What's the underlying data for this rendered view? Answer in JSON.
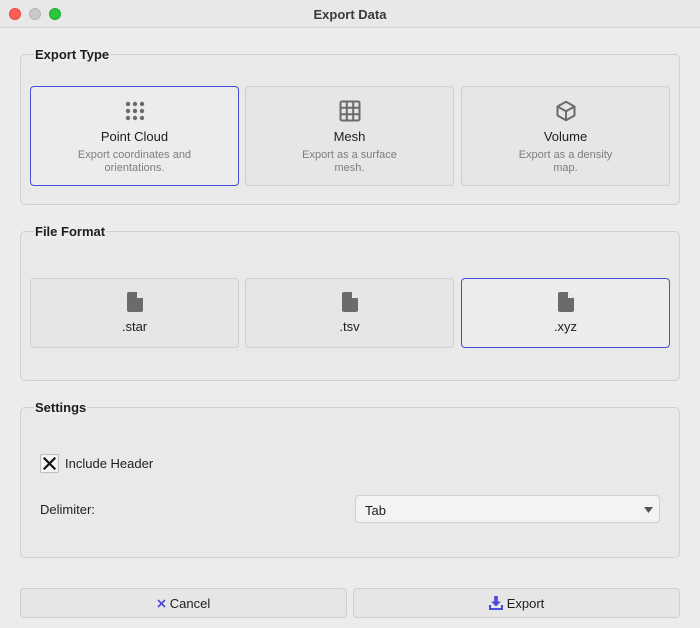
{
  "window": {
    "title": "Export Data"
  },
  "export_type": {
    "title": "Export Type",
    "options": [
      {
        "label": "Point Cloud",
        "description": "Export coordinates and orientations.",
        "icon": "dots-grid-icon",
        "selected": true
      },
      {
        "label": "Mesh",
        "description": "Export as a surface mesh.",
        "icon": "grid-icon",
        "selected": false
      },
      {
        "label": "Volume",
        "description": "Export as a density map.",
        "icon": "cube-icon",
        "selected": false
      }
    ]
  },
  "file_format": {
    "title": "File Format",
    "options": [
      {
        "label": ".star",
        "icon": "file-icon",
        "selected": false
      },
      {
        "label": ".tsv",
        "icon": "file-icon",
        "selected": false
      },
      {
        "label": ".xyz",
        "icon": "file-icon",
        "selected": true
      }
    ]
  },
  "settings": {
    "title": "Settings",
    "include_header": {
      "label": "Include Header",
      "checked": true
    },
    "delimiter": {
      "label": "Delimiter:",
      "value": "Tab"
    }
  },
  "buttons": {
    "cancel": {
      "label": "Cancel",
      "icon": "x-icon"
    },
    "export": {
      "label": "Export",
      "icon": "download-icon"
    }
  },
  "colors": {
    "accent": "#4b4ad6",
    "icon": "#6b6b6b"
  }
}
